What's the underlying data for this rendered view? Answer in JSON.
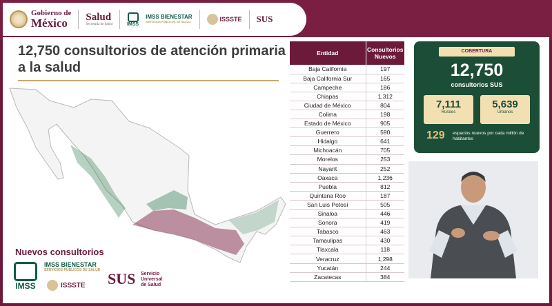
{
  "header": {
    "gobierno": "Gobierno de",
    "mexico": "México",
    "salud": "Salud",
    "salud_sub": "Secretaría de Salud",
    "imss": "IMSS",
    "bienestar": "IMSS BIENESTAR",
    "bienestar_sub": "SERVICIOS PÚBLICOS DE SALUD",
    "issste": "ISSSTE",
    "sus": "SUS"
  },
  "title": "12,750 consultorios de atención primaria a la salud",
  "nuevos_title": "Nuevos consultorios",
  "bottom_logos": {
    "imss": "IMSS",
    "bienestar": "IMSS BIENESTAR",
    "bienestar_sub": "SERVICIOS PÚBLICOS DE SALUD",
    "issste": "ISSSTE",
    "sus": "SUS",
    "sus_desc_1": "Servicio",
    "sus_desc_2": "Universal",
    "sus_desc_3": "de Salud"
  },
  "table": {
    "headers": [
      "Entidad",
      "Consultorios Nuevos"
    ],
    "rows": [
      [
        "Baja California",
        "197"
      ],
      [
        "Baja California Sur",
        "165"
      ],
      [
        "Campeche",
        "186"
      ],
      [
        "Chiapas",
        "1,312"
      ],
      [
        "Ciudad de México",
        "804"
      ],
      [
        "Colima",
        "198"
      ],
      [
        "Estado de México",
        "905"
      ],
      [
        "Guerrero",
        "590"
      ],
      [
        "Hidalgo",
        "641"
      ],
      [
        "Michoacán",
        "705"
      ],
      [
        "Morelos",
        "253"
      ],
      [
        "Nayarit",
        "252"
      ],
      [
        "Oaxaca",
        "1,236"
      ],
      [
        "Puebla",
        "812"
      ],
      [
        "Quintana Roo",
        "187"
      ],
      [
        "San Luis Potosí",
        "505"
      ],
      [
        "Sinaloa",
        "446"
      ],
      [
        "Sonora",
        "419"
      ],
      [
        "Tabasco",
        "463"
      ],
      [
        "Tamaulipas",
        "430"
      ],
      [
        "Tlaxcala",
        "118"
      ],
      [
        "Veracruz",
        "1,298"
      ],
      [
        "Yucatán",
        "244"
      ],
      [
        "Zacatecas",
        "384"
      ]
    ]
  },
  "cobertura": {
    "label": "COBERTURA",
    "value": "12,750",
    "sub": "consultorios SUS",
    "rurales_value": "7,111",
    "rurales_label": "Rurales",
    "urbanos_value": "5,639",
    "urbanos_label": "Urbanos",
    "per_million_value": "129",
    "per_million_text": "espacios nuevos por cada millón de habitantes"
  },
  "colors": {
    "brand": "#6b1a3a",
    "green": "#1c4d36",
    "gold": "#c9a96a"
  }
}
